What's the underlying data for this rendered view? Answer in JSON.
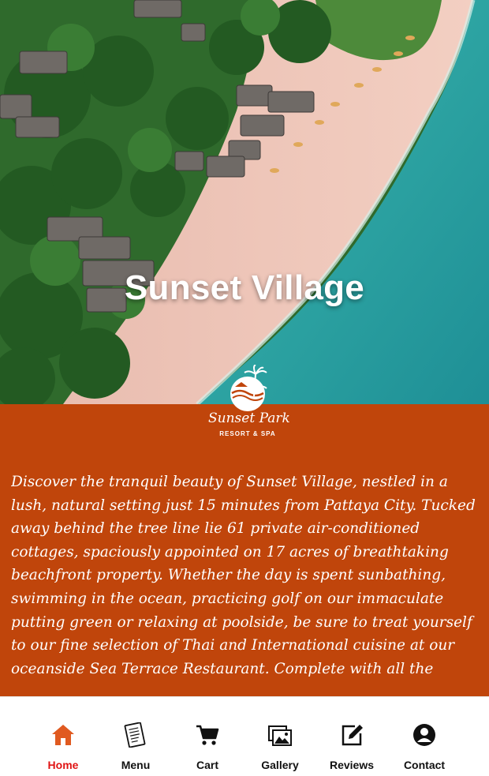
{
  "hero": {
    "title": "Sunset Village"
  },
  "logo": {
    "name": "Sunset Park",
    "subtitle": "RESORT & SPA"
  },
  "description": "Discover the tranquil beauty of Sunset Village, nestled in a lush, natural setting just 15 minutes from Pattaya City. Tucked away behind the tree line lie 61 private air-conditioned cottages, spaciously appointed on 17 acres of breathtaking beachfront property.  Whether the day is spent sunbathing, swimming in the ocean, practicing golf on our immaculate putting green or relaxing at poolside, be sure to treat yourself to our fine selection of Thai and International cuisine at our oceanside Sea Terrace Restaurant. Complete with all the amenities world-class travelers expect, Sunset",
  "colors": {
    "content_bg": "#c0450b",
    "active_tab": "#e01414",
    "sea": "#2aa3a0"
  },
  "nav": {
    "items": [
      {
        "label": "Home",
        "icon": "home-icon",
        "active": true
      },
      {
        "label": "Menu",
        "icon": "menu-book-icon",
        "active": false
      },
      {
        "label": "Cart",
        "icon": "cart-icon",
        "active": false
      },
      {
        "label": "Gallery",
        "icon": "gallery-icon",
        "active": false
      },
      {
        "label": "Reviews",
        "icon": "edit-icon",
        "active": false
      },
      {
        "label": "Contact",
        "icon": "contact-icon",
        "active": false
      }
    ]
  }
}
